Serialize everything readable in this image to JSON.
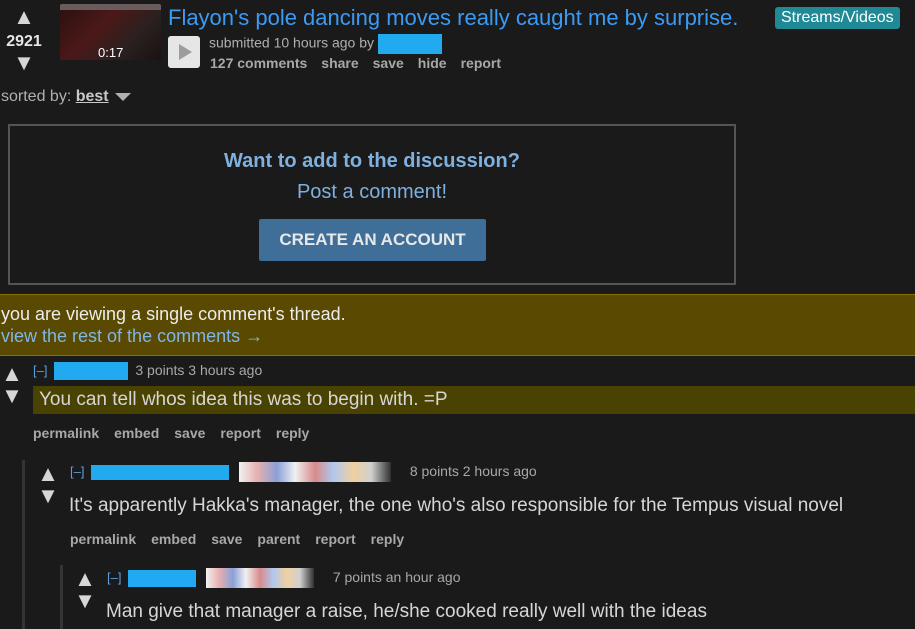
{
  "post": {
    "score": "2921",
    "thumb_time": "0:17",
    "title": "Flayon's pole dancing moves really caught me by surprise.",
    "flair": "Streams/Videos",
    "submitted": "submitted 10 hours ago by",
    "links": [
      "127 comments",
      "share",
      "save",
      "hide",
      "report"
    ]
  },
  "sort": {
    "label": "sorted by:",
    "value": "best"
  },
  "cta": {
    "question": "Want to add to the discussion?",
    "sub": "Post a comment!",
    "button": "CREATE AN ACCOUNT"
  },
  "notice": {
    "line1": "you are viewing a single comment's thread.",
    "line2": "view the rest of the comments →"
  },
  "comments": [
    {
      "collapse": "[–]",
      "meta": "3 points 3 hours ago",
      "body": "You can tell whos idea this was to begin with. =P",
      "links": [
        "permalink",
        "embed",
        "save",
        "report",
        "reply"
      ]
    },
    {
      "collapse": "[–]",
      "meta": "8 points 2 hours ago",
      "body": "It's apparently Hakka's manager, the one who's also responsible for the Tempus visual novel",
      "links": [
        "permalink",
        "embed",
        "save",
        "parent",
        "report",
        "reply"
      ]
    },
    {
      "collapse": "[–]",
      "meta": "7 points an hour ago",
      "body": "Man give that manager a raise, he/she cooked really well with the ideas"
    }
  ],
  "colors": {
    "link_blue": "#3a9bf5",
    "flair_bg": "#1f8a96",
    "highlight": "#4a4200",
    "redaction": "#22aaf0"
  }
}
